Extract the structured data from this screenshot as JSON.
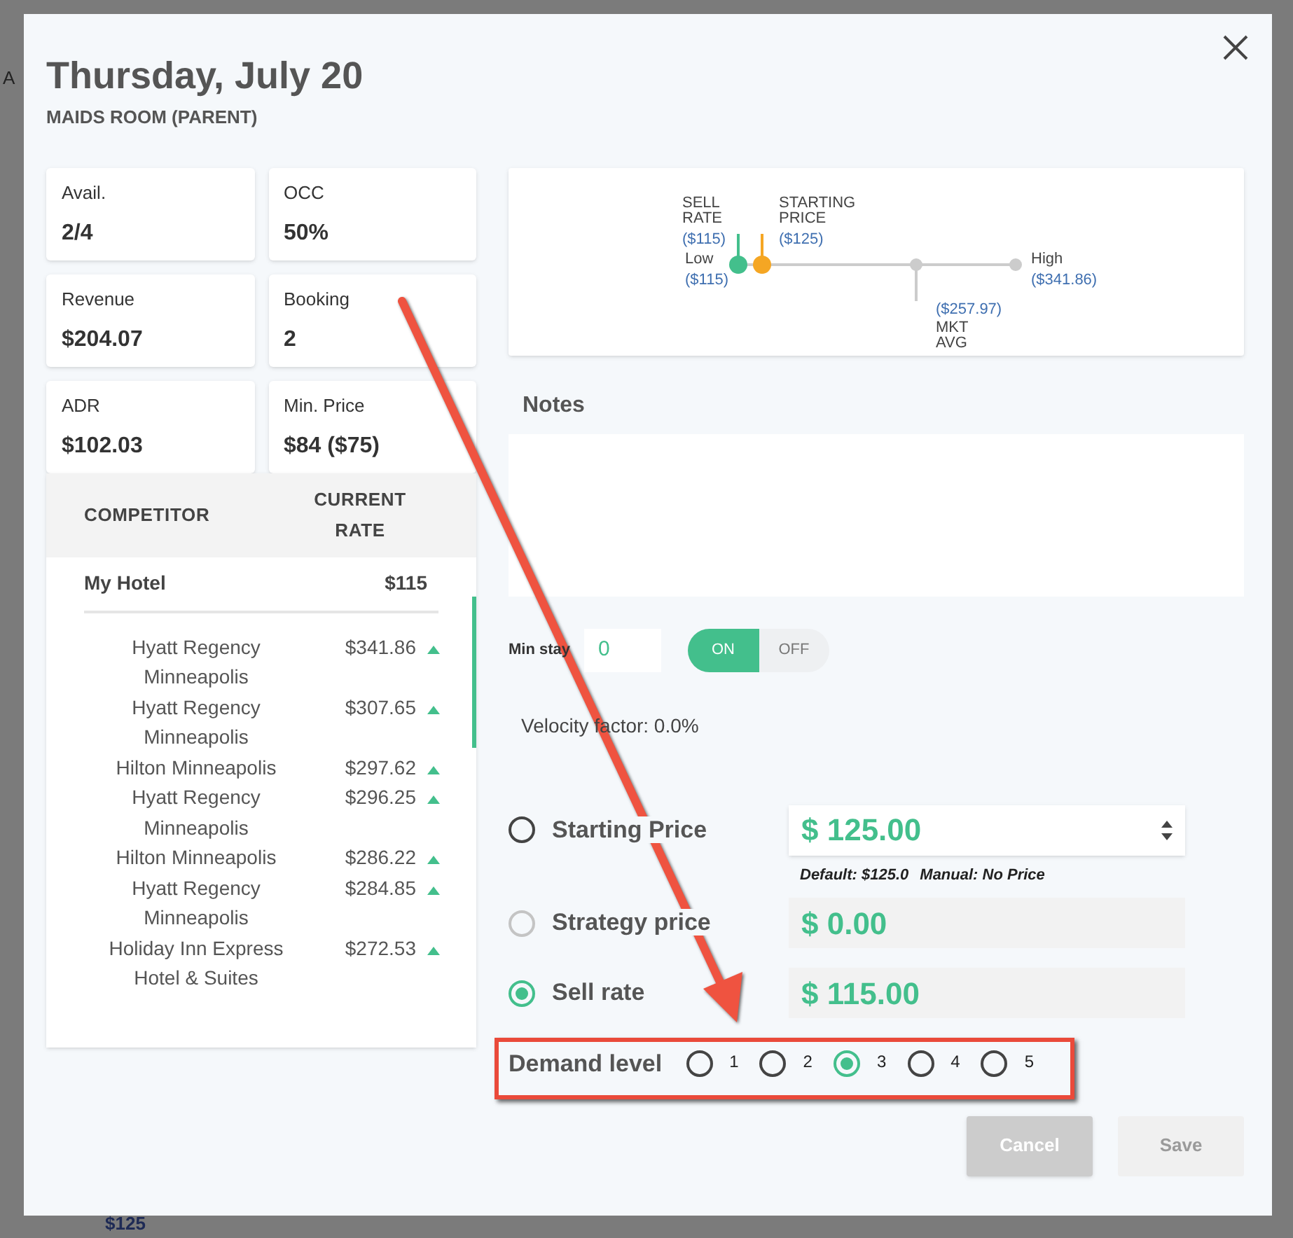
{
  "backdrop_texts": [
    "A",
    "$125"
  ],
  "title": "Thursday, July 20",
  "subtitle": "MAIDS ROOM (PARENT)",
  "stats": [
    {
      "label": "Avail.",
      "value": "2/4"
    },
    {
      "label": "OCC",
      "value": "50%"
    },
    {
      "label": "Revenue",
      "value": "$204.07"
    },
    {
      "label": "Booking",
      "value": "2"
    },
    {
      "label": "ADR",
      "value": "$102.03"
    },
    {
      "label": "Min. Price",
      "value": "$84 ($75)"
    }
  ],
  "competitors": {
    "columns": [
      "COMPETITOR",
      "CURRENT RATE"
    ],
    "my_hotel": {
      "name": "My Hotel",
      "rate": "$115"
    },
    "rows": [
      {
        "name": "Hyatt Regency Minneapolis",
        "rate": "$341.86"
      },
      {
        "name": "Hyatt Regency Minneapolis",
        "rate": "$307.65"
      },
      {
        "name": "Hilton Minneapolis",
        "rate": "$297.62"
      },
      {
        "name": "Hyatt Regency Minneapolis",
        "rate": "$296.25"
      },
      {
        "name": "Hilton Minneapolis",
        "rate": "$286.22"
      },
      {
        "name": "Hyatt Regency Minneapolis",
        "rate": "$284.85"
      },
      {
        "name": "Holiday Inn Express Hotel & Suites",
        "rate": "$272.53"
      }
    ]
  },
  "price_range": [
    {
      "kind": "sell_rate",
      "label_lines": [
        "SELL",
        "RATE"
      ],
      "value": "($115)"
    },
    {
      "kind": "starting_price",
      "label_lines": [
        "STARTING",
        "PRICE"
      ],
      "value": "($125)"
    },
    {
      "kind": "low",
      "label_lines": [
        "Low"
      ],
      "value": "($115)"
    },
    {
      "kind": "high",
      "label_lines": [
        "High"
      ],
      "value": "($341.86)"
    },
    {
      "kind": "market_avg",
      "label_lines": [
        "MKT",
        "AVG"
      ],
      "value": "($257.97)"
    }
  ],
  "notes": {
    "title": "Notes"
  },
  "min_stay": {
    "label": "Min stay",
    "value": "0"
  },
  "toggle": [
    {
      "label": "ON",
      "selected": true
    },
    {
      "label": "OFF",
      "selected": false
    }
  ],
  "velocity": "Velocity factor: 0.0%",
  "price_options": [
    {
      "label": "Starting Price",
      "value": "$ 125.00",
      "selected": false,
      "disabled": false,
      "kind": "spinner",
      "hints": [
        "Default: $125.0",
        "Manual: No Price"
      ]
    },
    {
      "label": "Strategy price",
      "value": "$ 0.00",
      "selected": false,
      "disabled": true,
      "kind": "readonly"
    },
    {
      "label": "Sell rate",
      "value": "$ 115.00",
      "selected": true,
      "disabled": false,
      "kind": "readonly"
    }
  ],
  "demand": {
    "label": "Demand level",
    "options": [
      {
        "label": "1",
        "selected": false
      },
      {
        "label": "2",
        "selected": false
      },
      {
        "label": "3",
        "selected": true
      },
      {
        "label": "4",
        "selected": false
      },
      {
        "label": "5",
        "selected": false
      }
    ]
  },
  "buttons": [
    {
      "label": "Cancel",
      "disabled": false
    },
    {
      "label": "Save",
      "disabled": true
    }
  ]
}
